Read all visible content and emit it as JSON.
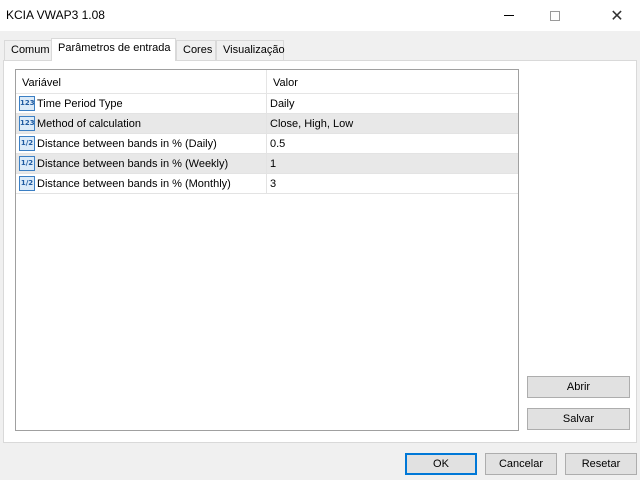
{
  "window": {
    "title": "KCIA VWAP3 1.08"
  },
  "tabs": [
    {
      "label": "Comum",
      "active": false
    },
    {
      "label": "Parâmetros de entrada",
      "active": true
    },
    {
      "label": "Cores",
      "active": false
    },
    {
      "label": "Visualização",
      "active": false
    }
  ],
  "grid": {
    "columns": [
      "Variável",
      "Valor"
    ],
    "rows": [
      {
        "icon": "integer-enum-icon",
        "icon_text": "123",
        "name": "Time Period Type",
        "value": "Daily"
      },
      {
        "icon": "integer-enum-icon",
        "icon_text": "123",
        "name": "Method of calculation",
        "value": "Close, High, Low"
      },
      {
        "icon": "fraction-number-icon",
        "icon_text": "1/2",
        "name": "Distance between bands in % (Daily)",
        "value": "0.5"
      },
      {
        "icon": "fraction-number-icon",
        "icon_text": "1/2",
        "name": "Distance between bands in % (Weekly)",
        "value": "1"
      },
      {
        "icon": "fraction-number-icon",
        "icon_text": "1/2",
        "name": "Distance between bands in % (Monthly)",
        "value": "3"
      }
    ]
  },
  "side_buttons": {
    "open_label": "Abrir",
    "save_label": "Salvar"
  },
  "footer_buttons": {
    "ok_label": "OK",
    "cancel_label": "Cancelar",
    "reset_label": "Resetar"
  },
  "colors": {
    "accent": "#0078d7",
    "row_alt": "#e8e8e8",
    "icon_blue": "#3b7fc4"
  }
}
